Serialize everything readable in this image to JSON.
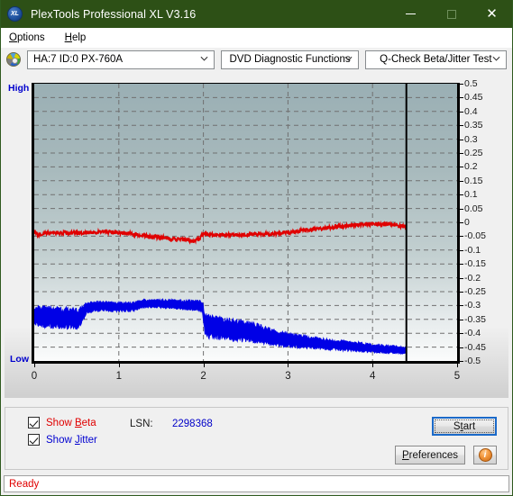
{
  "window": {
    "title": "PlexTools Professional XL V3.16",
    "icon": "xl-logo-icon",
    "minimize": "—",
    "maximize": "□",
    "close": "✕"
  },
  "menubar": {
    "items": [
      {
        "label": "Options",
        "accel": "O"
      },
      {
        "label": "Help",
        "accel": "H"
      }
    ]
  },
  "toolbar": {
    "drive_icon": "disc-icon",
    "drive": "HA:7 ID:0  PX-760A",
    "function": "DVD Diagnostic Functions",
    "test": "Q-Check Beta/Jitter Test"
  },
  "chart_labels": {
    "high": "High",
    "low": "Low"
  },
  "controls": {
    "show_beta": {
      "label_pre": "Show ",
      "accel": "B",
      "label_post": "eta",
      "checked": true,
      "color": "#e00000"
    },
    "show_jitter": {
      "label_pre": "Show ",
      "accel": "J",
      "label_post": "itter",
      "checked": true,
      "color": "#0000d0"
    },
    "lsn_label": "LSN:",
    "lsn_value": "2298368",
    "start_pre": "S",
    "start_accel": "t",
    "start_post": "art",
    "start_label": "Start",
    "prefs_pre": "",
    "prefs_accel": "P",
    "prefs_post": "references",
    "prefs_label": "Preferences",
    "info_label": "i"
  },
  "statusbar": {
    "text": "Ready"
  },
  "chart_data": {
    "type": "line",
    "title": "Q-Check Beta/Jitter Test",
    "xlabel": "",
    "ylabel": "",
    "xlim": [
      0,
      5
    ],
    "ylim": [
      -0.5,
      0.5
    ],
    "xticks": [
      0,
      1,
      2,
      3,
      4,
      5
    ],
    "yticks": [
      0.5,
      0.45,
      0.4,
      0.35,
      0.3,
      0.25,
      0.2,
      0.15,
      0.1,
      0.05,
      0,
      -0.05,
      -0.1,
      -0.15,
      -0.2,
      -0.25,
      -0.3,
      -0.35,
      -0.4,
      -0.45,
      -0.5
    ],
    "ytick_labels": [
      "0.5",
      "0.45",
      "0.4",
      "0.35",
      "0.3",
      "0.25",
      "0.2",
      "0.15",
      "0.1",
      "0.05",
      "0",
      "-0.05",
      "-0.1",
      "-0.15",
      "-0.2",
      "-0.25",
      "-0.3",
      "-0.35",
      "-0.4",
      "-0.45",
      "-0.5"
    ],
    "xtick_labels": [
      "0",
      "1",
      "2",
      "3",
      "4",
      "5"
    ],
    "grid": true,
    "grid_style": "dashed",
    "grid_color": "#707070",
    "data_end_marker_x": 4.4,
    "axis_high_label": "High",
    "axis_low_label": "Low",
    "series": [
      {
        "name": "Beta",
        "color": "#e00000",
        "noise": 0.007,
        "x": [
          0.0,
          0.05,
          0.12,
          0.2,
          0.3,
          0.42,
          0.55,
          0.7,
          0.85,
          1.0,
          1.1,
          1.22,
          1.35,
          1.5,
          1.62,
          1.75,
          1.88,
          1.95,
          2.0,
          2.05,
          2.12,
          2.25,
          2.4,
          2.55,
          2.7,
          2.85,
          3.0,
          3.15,
          3.3,
          3.45,
          3.6,
          3.75,
          3.9,
          4.05,
          4.2,
          4.3,
          4.4
        ],
        "values": [
          -0.035,
          -0.045,
          -0.04,
          -0.036,
          -0.038,
          -0.038,
          -0.038,
          -0.036,
          -0.035,
          -0.037,
          -0.04,
          -0.044,
          -0.05,
          -0.055,
          -0.06,
          -0.062,
          -0.068,
          -0.06,
          -0.04,
          -0.042,
          -0.045,
          -0.046,
          -0.045,
          -0.044,
          -0.043,
          -0.04,
          -0.036,
          -0.03,
          -0.025,
          -0.02,
          -0.015,
          -0.01,
          -0.006,
          -0.005,
          -0.008,
          -0.012,
          -0.016
        ]
      },
      {
        "name": "Jitter",
        "color": "#0000e6",
        "x": [
          0.0,
          0.05,
          0.1,
          0.18,
          0.28,
          0.4,
          0.52,
          0.62,
          0.7,
          0.8,
          0.92,
          1.05,
          1.18,
          1.25,
          1.28,
          1.4,
          1.55,
          1.7,
          1.85,
          1.95,
          1.99,
          2.02,
          2.1,
          2.25,
          2.4,
          2.55,
          2.7,
          2.85,
          3.0,
          3.2,
          3.4,
          3.6,
          3.8,
          4.0,
          4.15,
          4.3,
          4.4
        ],
        "band_top": [
          -0.3,
          -0.302,
          -0.305,
          -0.3,
          -0.305,
          -0.308,
          -0.31,
          -0.29,
          -0.285,
          -0.285,
          -0.288,
          -0.288,
          -0.288,
          -0.28,
          -0.278,
          -0.278,
          -0.278,
          -0.28,
          -0.28,
          -0.282,
          -0.285,
          -0.33,
          -0.338,
          -0.345,
          -0.352,
          -0.36,
          -0.372,
          -0.388,
          -0.398,
          -0.408,
          -0.418,
          -0.424,
          -0.43,
          -0.438,
          -0.442,
          -0.446,
          -0.45
        ],
        "band_bot": [
          -0.37,
          -0.378,
          -0.382,
          -0.38,
          -0.382,
          -0.384,
          -0.384,
          -0.33,
          -0.322,
          -0.32,
          -0.322,
          -0.322,
          -0.32,
          -0.312,
          -0.308,
          -0.308,
          -0.31,
          -0.312,
          -0.316,
          -0.32,
          -0.325,
          -0.415,
          -0.418,
          -0.422,
          -0.428,
          -0.432,
          -0.438,
          -0.445,
          -0.45,
          -0.455,
          -0.458,
          -0.462,
          -0.466,
          -0.47,
          -0.472,
          -0.474,
          -0.476
        ]
      }
    ]
  }
}
